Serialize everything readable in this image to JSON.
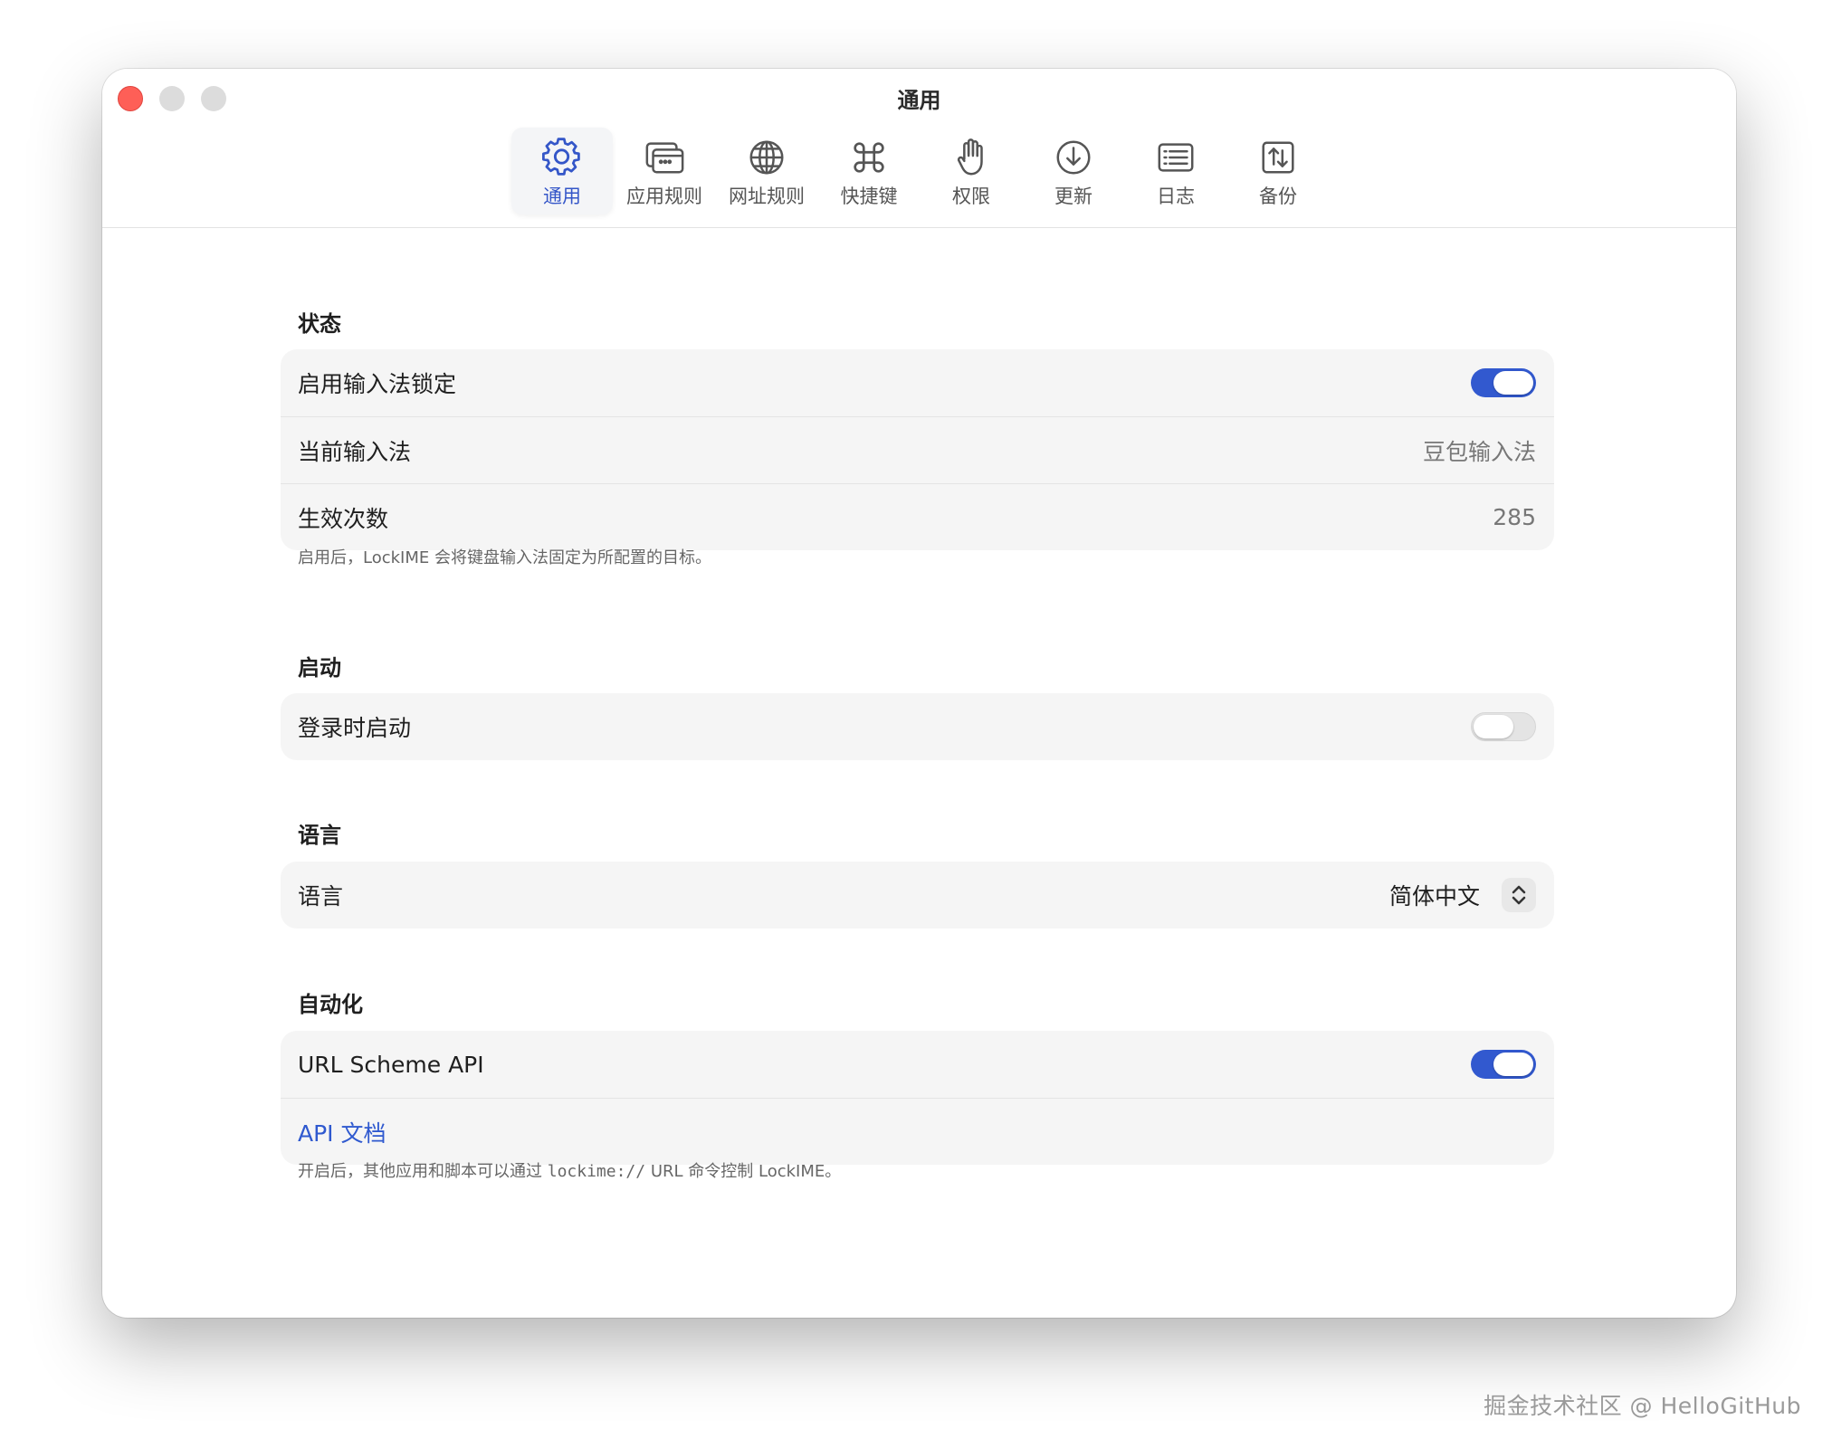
{
  "window": {
    "title": "通用"
  },
  "toolbar": {
    "tabs": [
      {
        "label": "通用",
        "icon": "gear-icon",
        "active": true
      },
      {
        "label": "应用规则",
        "icon": "app-windows-icon",
        "active": false
      },
      {
        "label": "网址规则",
        "icon": "globe-icon",
        "active": false
      },
      {
        "label": "快捷键",
        "icon": "command-key-icon",
        "active": false
      },
      {
        "label": "权限",
        "icon": "hand-icon",
        "active": false
      },
      {
        "label": "更新",
        "icon": "download-circle-icon",
        "active": false
      },
      {
        "label": "日志",
        "icon": "log-list-icon",
        "active": false
      },
      {
        "label": "备份",
        "icon": "backup-arrows-icon",
        "active": false
      }
    ]
  },
  "status": {
    "title": "状态",
    "enable_lock": {
      "label": "启用输入法锁定",
      "on": true
    },
    "current_ime": {
      "label": "当前输入法",
      "value": "豆包输入法"
    },
    "effect_count": {
      "label": "生效次数",
      "value": "285"
    },
    "note": "启用后，LockIME 会将键盘输入法固定为所配置的目标。"
  },
  "launch": {
    "title": "启动",
    "login_launch": {
      "label": "登录时启动",
      "on": false
    }
  },
  "language": {
    "title": "语言",
    "row_label": "语言",
    "selected": "简体中文"
  },
  "automation": {
    "title": "自动化",
    "url_scheme": {
      "label": "URL Scheme API",
      "on": true
    },
    "api_docs_link": "API 文档",
    "note_prefix": "开启后，其他应用和脚本可以通过",
    "note_code": "lockime://",
    "note_suffix": "URL 命令控制 LockIME。"
  },
  "watermark": "掘金技术社区 @ HelloGitHub",
  "colors": {
    "accent": "#3259cf",
    "close": "#fe5f57",
    "card_bg": "#f5f5f5"
  }
}
